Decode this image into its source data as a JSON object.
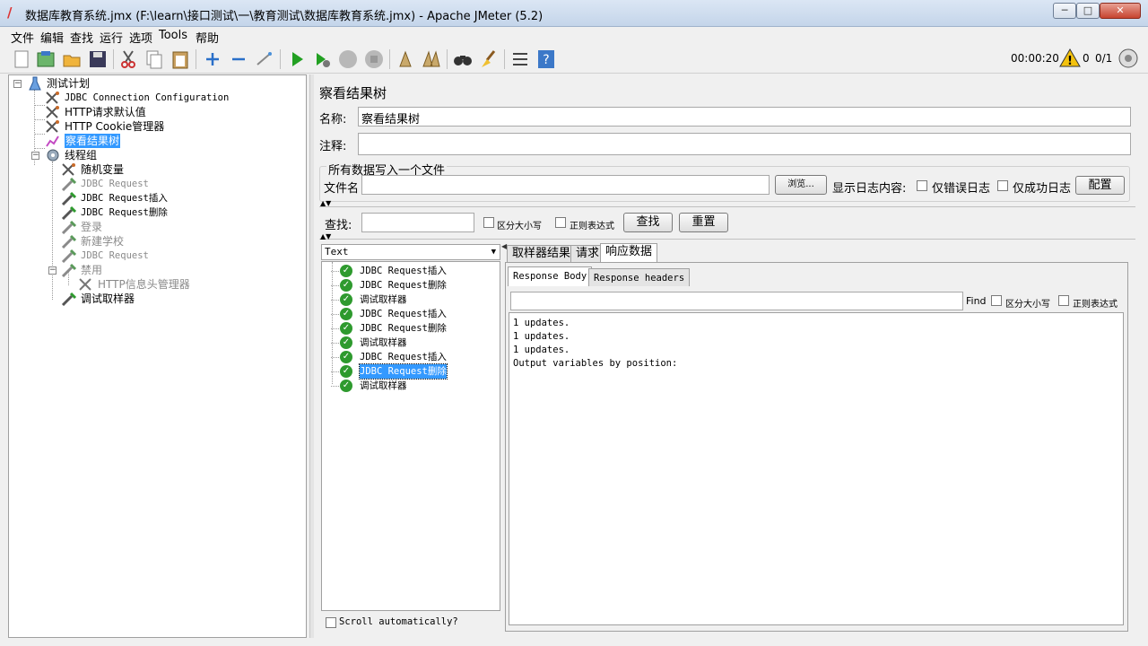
{
  "window": {
    "title": "数据库教育系统.jmx (F:\\learn\\接口测试\\一\\教育测试\\数据库教育系统.jmx) - Apache JMeter (5.2)",
    "min": "─",
    "max": "□",
    "close": "✕"
  },
  "menubar": [
    "文件",
    "编辑",
    "查找",
    "运行",
    "选项",
    "Tools",
    "帮助"
  ],
  "status": {
    "elapsed": "00:00:20",
    "warnings": "0",
    "threads": "0/1"
  },
  "tree": {
    "plan": "测试计划",
    "items": [
      {
        "label": "JDBC Connection Configuration",
        "icon": "config-icon"
      },
      {
        "label": "HTTP请求默认值",
        "icon": "config-icon"
      },
      {
        "label": "HTTP Cookie管理器",
        "icon": "config-icon"
      },
      {
        "label": "察看结果树",
        "icon": "listener-icon"
      }
    ],
    "threadgroup": "线程组",
    "children": [
      {
        "label": "随机变量",
        "icon": "config-icon",
        "disabled": false
      },
      {
        "label": "JDBC Request",
        "icon": "sampler-icon",
        "disabled": true
      },
      {
        "label": "JDBC Request插入",
        "icon": "sampler-icon",
        "disabled": false
      },
      {
        "label": "JDBC Request删除",
        "icon": "sampler-icon",
        "disabled": false
      },
      {
        "label": "登录",
        "icon": "sampler-icon",
        "disabled": true
      },
      {
        "label": "新建学校",
        "icon": "sampler-icon",
        "disabled": true
      },
      {
        "label": "JDBC Request",
        "icon": "sampler-icon",
        "disabled": true
      },
      {
        "label": "禁用",
        "icon": "sampler-icon",
        "disabled": true
      }
    ],
    "sub": {
      "label": "HTTP信息头管理器",
      "icon": "config-icon"
    },
    "last": {
      "label": "调试取样器",
      "icon": "sampler-icon"
    }
  },
  "panel": {
    "title": "察看结果树",
    "name_label": "名称:",
    "name_value": "察看结果树",
    "comment_label": "注释:",
    "comment_value": "",
    "file_group": "所有数据写入一个文件",
    "filename_label": "文件名",
    "browse": "浏览...",
    "log_content": "显示日志内容:",
    "errors_only": "仅错误日志",
    "success_only": "仅成功日志",
    "configure": "配置",
    "search_label": "查找:",
    "case_sensitive": "区分大小写",
    "regex": "正则表达式",
    "find_btn": "查找",
    "reset_btn": "重置",
    "renderer": "Text",
    "scroll_auto": "Scroll automatically?"
  },
  "results": [
    "JDBC Request插入",
    "JDBC Request删除",
    "调试取样器",
    "JDBC Request插入",
    "JDBC Request删除",
    "调试取样器",
    "JDBC Request插入",
    "JDBC Request删除",
    "调试取样器"
  ],
  "tabs": [
    "取样器结果",
    "请求",
    "响应数据"
  ],
  "subtabs": [
    "Response Body",
    "Response headers"
  ],
  "find": {
    "label": "Find",
    "case": "区分大小写",
    "regex": "正则表达式"
  },
  "response_lines": [
    "1 updates.",
    "1 updates.",
    "1 updates.",
    "Output variables by position:"
  ]
}
